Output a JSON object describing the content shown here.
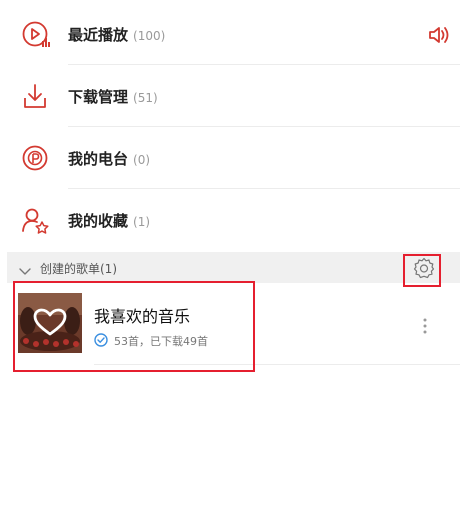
{
  "menu": {
    "items": [
      {
        "label": "最近播放",
        "count": "(100)",
        "icon": "recent-play-icon"
      },
      {
        "label": "下载管理",
        "count": "(51)",
        "icon": "download-icon"
      },
      {
        "label": "我的电台",
        "count": "(0)",
        "icon": "radio-icon"
      },
      {
        "label": "我的收藏",
        "count": "(1)",
        "icon": "favorites-icon"
      }
    ],
    "now_playing_icon": "speaker-icon"
  },
  "section": {
    "title": "创建的歌单(1)",
    "collapse_icon": "chevron-down-icon",
    "settings_icon": "gear-icon"
  },
  "playlist": {
    "name": "我喜欢的音乐",
    "meta": "53首，已下载49首",
    "cover_icon": "heart-icon",
    "status_icon": "check-circle-icon",
    "more_icon": "more-vertical-icon"
  },
  "colors": {
    "accent": "#d33a31",
    "highlight": "#e51f2f",
    "download_status": "#3b8fe0"
  }
}
